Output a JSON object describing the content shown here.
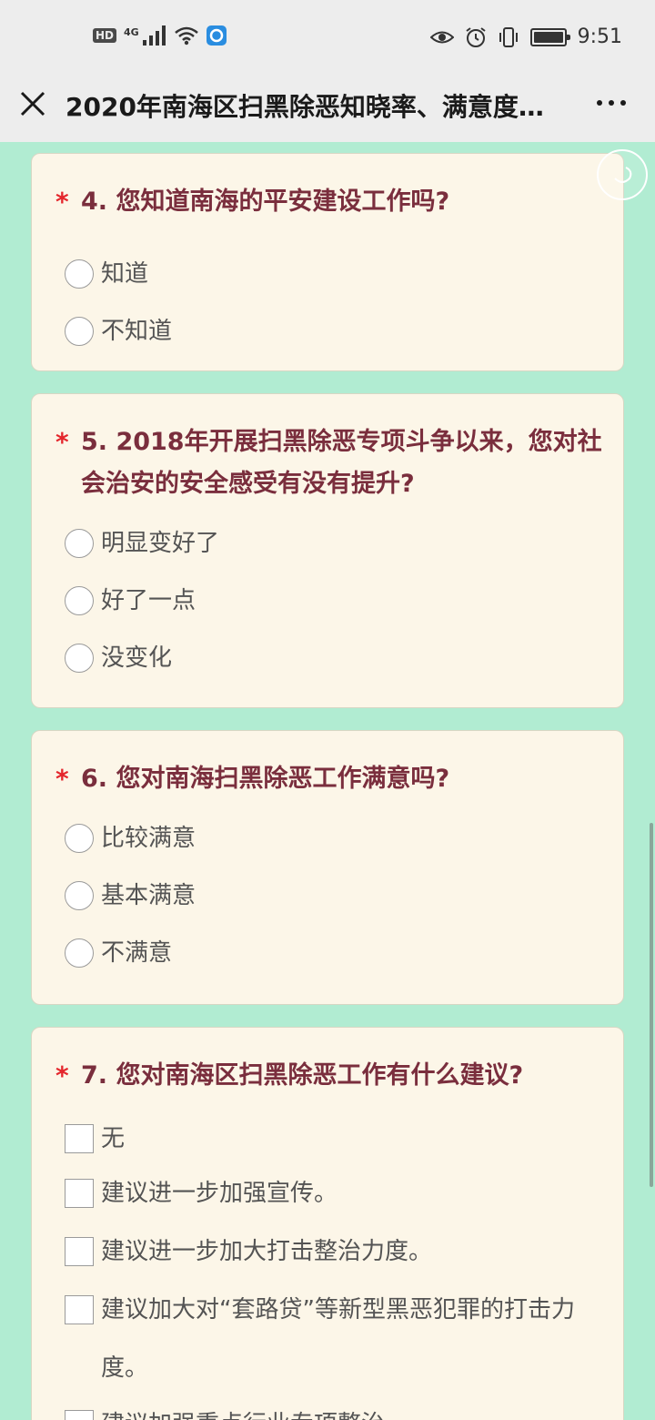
{
  "status_bar": {
    "hd": "HD",
    "signal": "4G",
    "time": "9:51"
  },
  "nav": {
    "title": "2020年南海区扫黑除恶知晓率、满意度…"
  },
  "questions": [
    {
      "star": "*",
      "title": "4. 您知道南海的平安建设工作吗?",
      "options": [
        "知道",
        "不知道"
      ]
    },
    {
      "star": "*",
      "title": "5. 2018年开展扫黑除恶专项斗争以来，您对社会治安的安全感受有没有提升?",
      "options": [
        "明显变好了",
        "好了一点",
        "没变化"
      ]
    },
    {
      "star": "*",
      "title": "6. 您对南海扫黑除恶工作满意吗?",
      "options": [
        "比较满意",
        "基本满意",
        "不满意"
      ]
    },
    {
      "star": "*",
      "title": "7. 您对南海区扫黑除恶工作有什么建议?",
      "options": [
        "无",
        "建议进一步加强宣传。",
        "建议进一步加大打击整治力度。",
        "建议加大对“套路贷”等新型黑恶犯罪的打击力度。",
        "建议加强重点行业专项整治"
      ]
    }
  ]
}
